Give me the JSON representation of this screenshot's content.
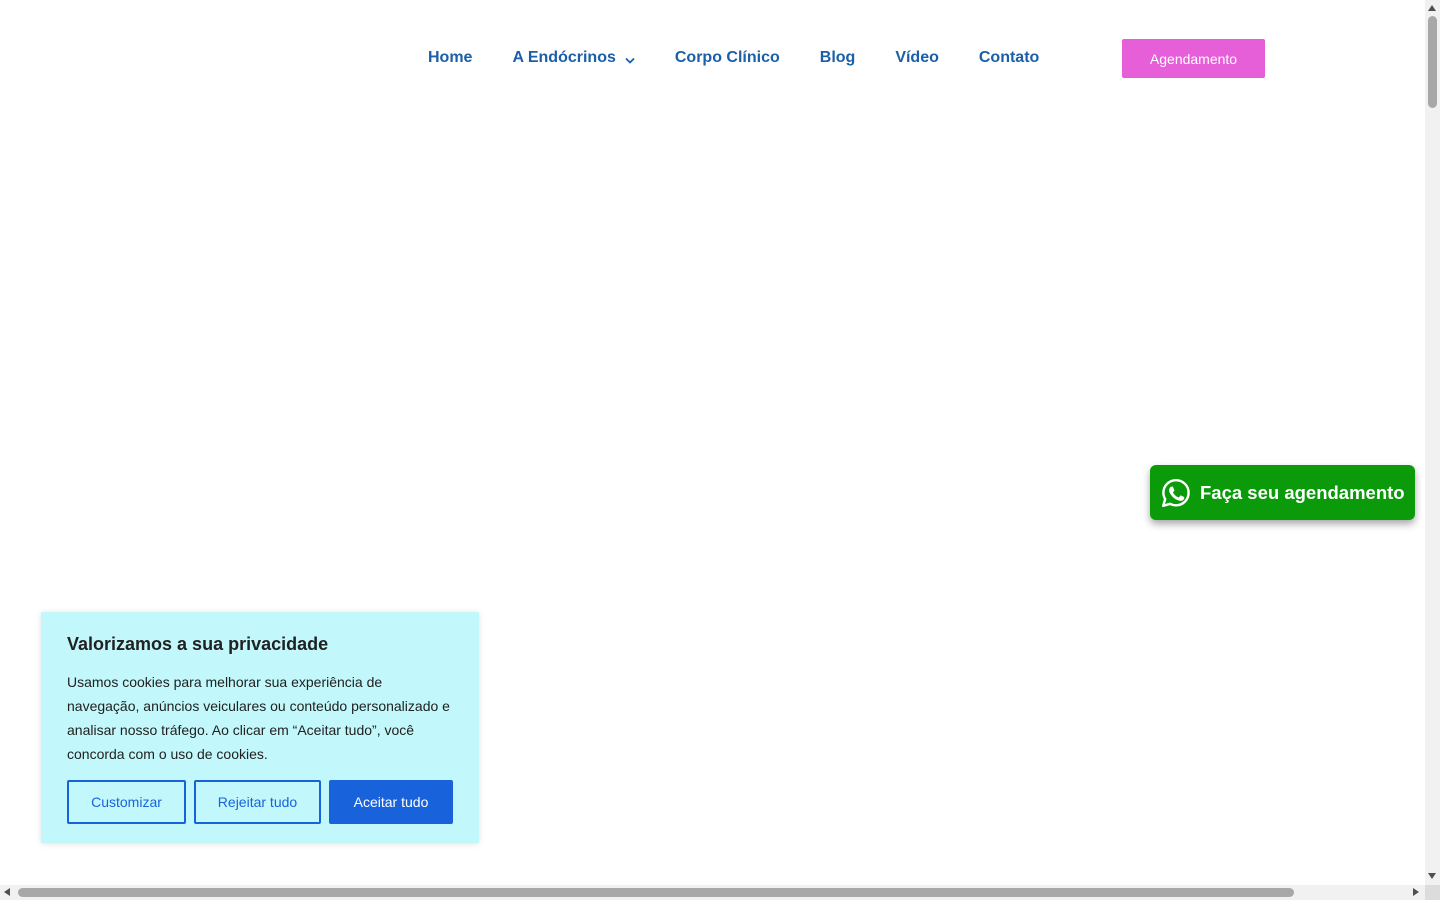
{
  "nav": {
    "items": [
      {
        "label": "Home"
      },
      {
        "label": "A Endócrinos",
        "has_dropdown": true
      },
      {
        "label": "Corpo Clínico"
      },
      {
        "label": "Blog"
      },
      {
        "label": "Vídeo"
      },
      {
        "label": "Contato"
      }
    ],
    "cta_label": "Agendamento"
  },
  "whatsapp": {
    "label": "Faça seu agendamento",
    "icon": "whatsapp-icon"
  },
  "cookie_banner": {
    "title": "Valorizamos a sua privacidade",
    "text": "Usamos cookies para melhorar sua experiência de navegação, anúncios veiculares ou conteúdo personalizado e analisar nosso tráfego. Ao clicar em “Aceitar tudo”, você concorda com o uso de cookies.",
    "customize_label": "Customizar",
    "reject_label": "Rejeitar tudo",
    "accept_label": "Aceitar tudo"
  },
  "colors": {
    "nav_text": "#1a5fa8",
    "cta_background": "#e65fd8",
    "whatsapp_background": "#0a9a0a",
    "cookie_background": "#c2f8fb",
    "cookie_button": "#1863dc"
  }
}
